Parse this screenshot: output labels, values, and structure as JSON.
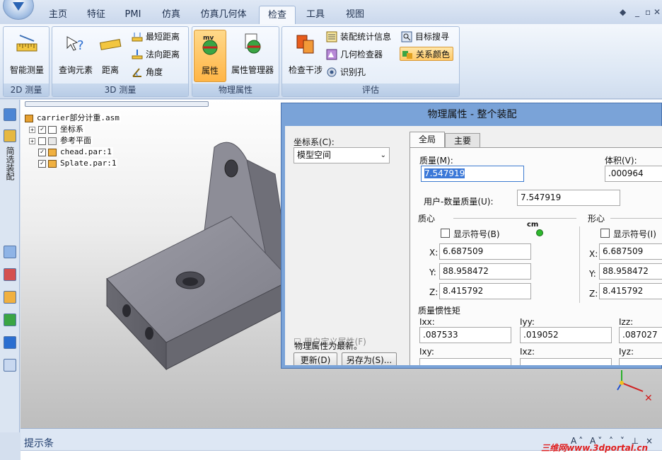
{
  "tabs": [
    "主页",
    "特征",
    "PMI",
    "仿真",
    "仿真几何体",
    "检查",
    "工具",
    "视图"
  ],
  "active_tab": "检查",
  "ribbon": {
    "group_2d": {
      "label": "2D 测量",
      "smart_measure": "智能测量"
    },
    "group_3d": {
      "label": "3D 测量",
      "query_element": "查询元素",
      "distance": "距离",
      "shortest_distance": "最短距离",
      "normal_distance": "法向距离",
      "angle": "角度"
    },
    "group_phys": {
      "label": "物理属性",
      "properties": "属性",
      "properties_manager": "属性管理器",
      "mv_badge": "mv"
    },
    "group_eval": {
      "label": "评估",
      "interference": "检查干涉",
      "assembly_stats": "装配统计信息",
      "geometry_inspector": "几何检查器",
      "identify_holes": "识别孔",
      "target_search": "目标搜寻",
      "relation_colors": "关系颜色"
    }
  },
  "left_strip": {
    "vertical_text": "简选装配"
  },
  "tree": {
    "root": "carrier部分计重.asm",
    "items": [
      {
        "label": "坐标系",
        "checked": "✓"
      },
      {
        "label": "参考平面",
        "checked": ""
      },
      {
        "label": "chead.par:1",
        "checked": "✓"
      },
      {
        "label": "Splate.par:1",
        "checked": "✓"
      }
    ]
  },
  "dialog": {
    "title": "物理属性 - 整个装配",
    "coord_label": "坐标系(C):",
    "coord_value": "模型空间",
    "user_defined_label": "用户定义属性(F)",
    "update_button": "更新(D)",
    "save_as_button": "另存为(S)...",
    "status": "物理属性为最新。",
    "tab_global": "全局",
    "tab_principal": "主要",
    "mass_label": "质量(M):",
    "mass_value": "7.547919",
    "volume_label": "体积(V):",
    "volume_value": ".000964",
    "user_mass_label": "用户-数量质量(U):",
    "user_mass_value": "7.547919",
    "com_label": "质心",
    "centroid_label": "形心",
    "show_symbol_b": "显示符号(B)",
    "show_symbol_i": "显示符号(I)",
    "cm_badge": "cm",
    "x_label": "X:",
    "y_label": "Y:",
    "z_label": "Z:",
    "com_x": "6.687509",
    "com_y": "88.958472",
    "com_z": "8.415792",
    "cen_x": "6.687509",
    "cen_y": "88.958472",
    "cen_z": "8.415792",
    "inertia_label": "质量惯性矩",
    "ixx_label": "Ixx:",
    "ixx": ".087533",
    "iyy_label": "Iyy:",
    "iyy": ".019052",
    "izz_label": "Izz:",
    "izz": ".087027",
    "ixy_label": "Ixy:",
    "ixz_label": "Ixz:",
    "iyz_label": "Iyz:"
  },
  "prompt_bar": {
    "label": "提示条",
    "tools": "A˄ A˅ ˄ ˅ ⊥ ×"
  },
  "watermark": "三维网www.3dportal.cn",
  "colors": {
    "accent": "#ffb546",
    "dialog_frame": "#7aa3d8",
    "ribbon": "#dbe6f4"
  }
}
